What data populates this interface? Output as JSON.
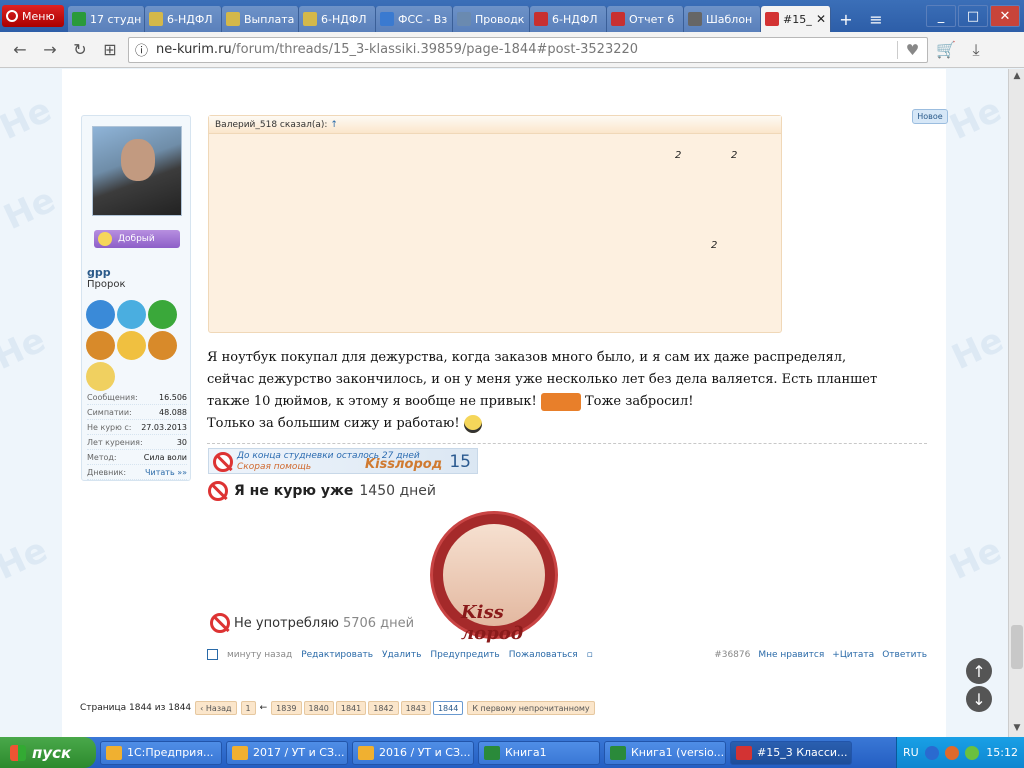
{
  "browser": {
    "menu_label": "Меню",
    "tabs": [
      {
        "label": "17 студн",
        "color": "#2a9a3a"
      },
      {
        "label": "6-НДФЛ",
        "color": "#d4b84a"
      },
      {
        "label": "Выплата",
        "color": "#d4b84a"
      },
      {
        "label": "6-НДФЛ",
        "color": "#d4b84a"
      },
      {
        "label": "ФСС - Вз",
        "color": "#3a7ad0"
      },
      {
        "label": "Проводк",
        "color": "#6a8ab0"
      },
      {
        "label": "6-НДФЛ",
        "color": "#c83030"
      },
      {
        "label": "Отчет 6",
        "color": "#c83030"
      },
      {
        "label": "Шаблон",
        "color": "#666666"
      },
      {
        "label": "#15_",
        "color": "#d33333"
      }
    ],
    "url_domain": "ne-kurim.ru",
    "url_path": "/forum/threads/15_3-klassiki.39859/page-1844#post-3523220"
  },
  "post": {
    "new_badge": "Новое",
    "user": {
      "mood": "Добрый",
      "name": "gpp",
      "title": "Пророк",
      "stats": [
        {
          "k": "Сообщения:",
          "v": "16.506"
        },
        {
          "k": "Симпатии:",
          "v": "48.088"
        },
        {
          "k": "Не курю с:",
          "v": "27.03.2013"
        },
        {
          "k": "Лет курения:",
          "v": "30"
        },
        {
          "k": "Метод:",
          "v": "Сила воли"
        },
        {
          "k": "Дневник:",
          "v": "Читать »»"
        }
      ]
    },
    "quote": {
      "author": "Валерий_518 сказал(а):",
      "arrow": "↑",
      "marks": [
        "2",
        "2",
        "2"
      ]
    },
    "message": {
      "line1": "Я ноутбук покупал для дежурства, когда заказов много было, и я сам их даже распределял, сейчас дежурство закончилось, и он у меня уже несколько лет без дела валяется. Есть планшет также 10 дюймов, к этому я вообще не привык!",
      "line1_tail": "Тоже забросил!",
      "line2": "Только за большим сижу и работаю!"
    },
    "signature": {
      "banner1_top": "До конца студневки осталось 27 дней",
      "banner1_bottom": "Скорая помощь",
      "banner1_logo": "Kissлород",
      "banner1_num": "15",
      "banner2_text": "Я не курю уже",
      "banner2_num": "1450 дней",
      "kiss_text": "Kiss лород",
      "banner3_text": "Не употребляю",
      "banner3_num": "5706 дней"
    },
    "actions": {
      "time": "минуту назад",
      "edit": "Редактировать",
      "delete": "Удалить",
      "warn": "Предупредить",
      "report": "Пожаловаться",
      "post_no": "#36876",
      "like": "Мне нравится",
      "quote": "+Цитата",
      "reply": "Ответить"
    }
  },
  "pager": {
    "label": "Страница 1844 из 1844",
    "prev": "‹ Назад",
    "first": "1",
    "dots": "←",
    "pages": [
      "1839",
      "1840",
      "1841",
      "1842",
      "1843",
      "1844"
    ],
    "current": "1844",
    "unread": "К первому непрочитанному"
  },
  "taskbar": {
    "start": "пуск",
    "tasks": [
      {
        "label": "1С:Предприя...",
        "color": "#f0b030"
      },
      {
        "label": "2017 / УТ и СЗ...",
        "color": "#f0b030"
      },
      {
        "label": "2016 / УТ и СЗ...",
        "color": "#f0b030"
      },
      {
        "label": "Книга1",
        "color": "#2a8a3a"
      },
      {
        "label": "Книга1 (versio...",
        "color": "#2a8a3a"
      },
      {
        "label": "#15_3 Класси...",
        "color": "#d33333"
      }
    ],
    "lang": "RU",
    "time": "15:12"
  }
}
